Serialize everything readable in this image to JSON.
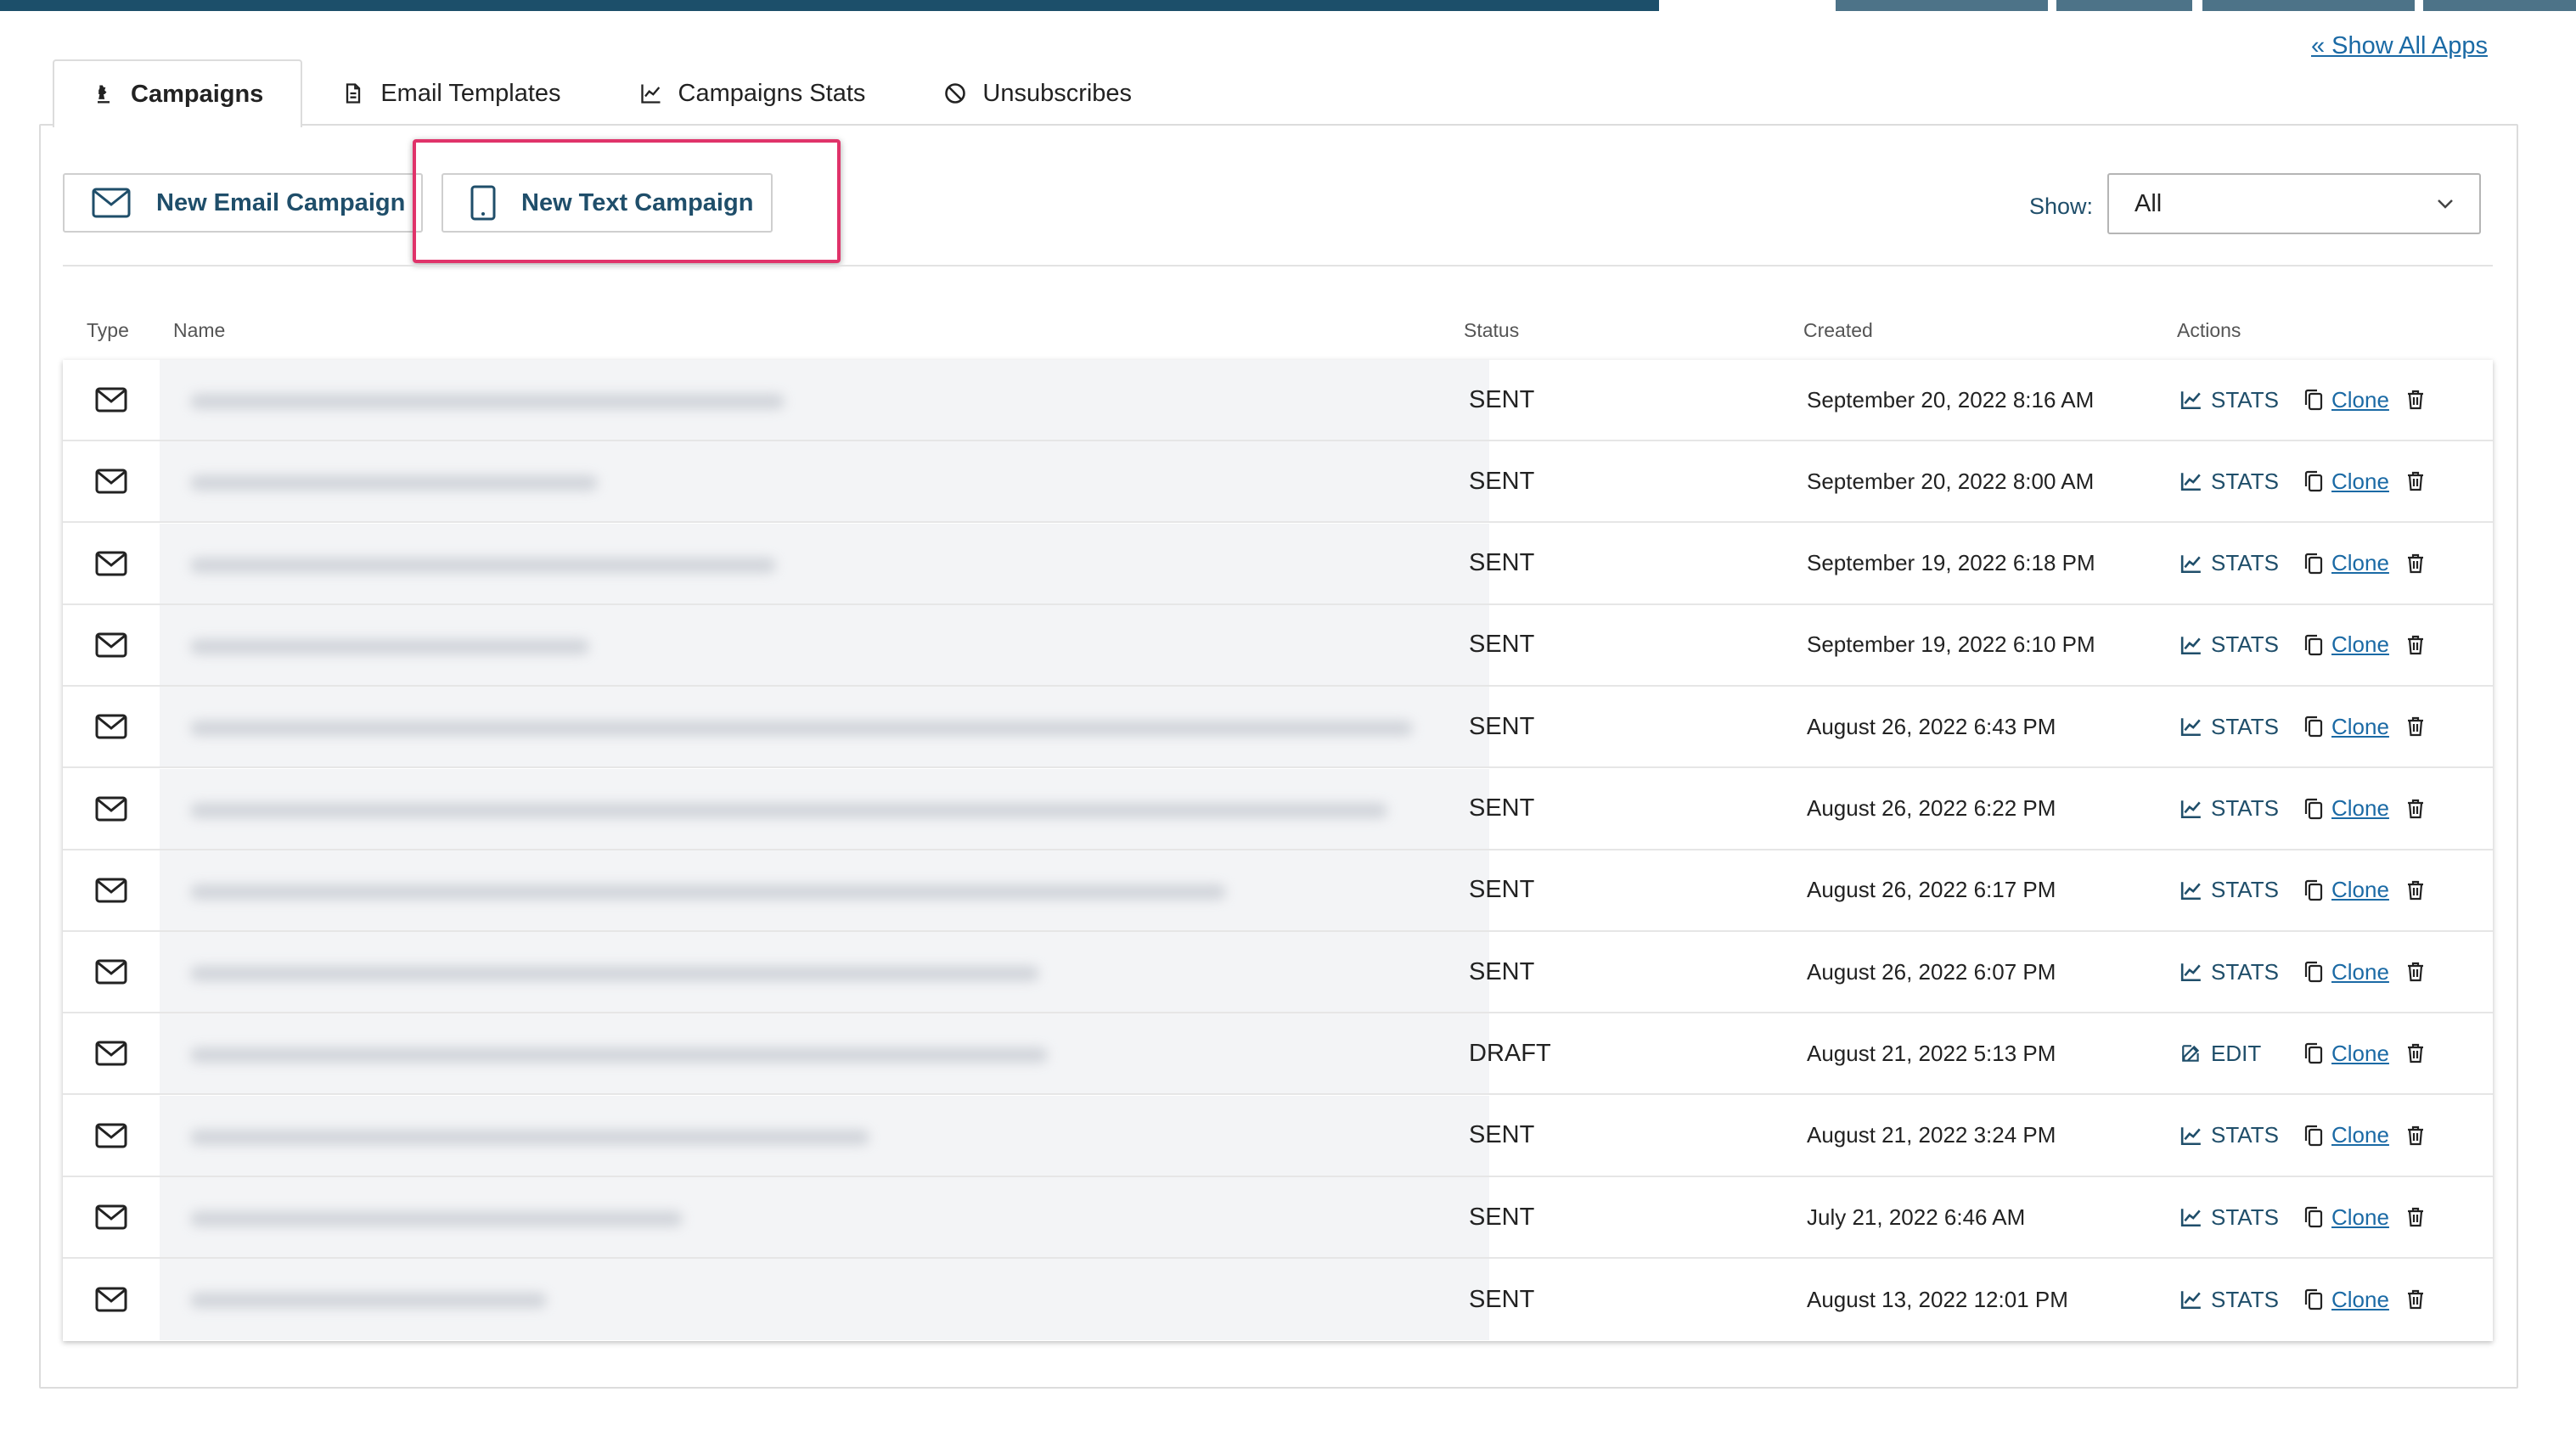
{
  "header": {
    "show_all_apps": "« Show All Apps"
  },
  "tabs": [
    {
      "label": "Campaigns",
      "icon": "chess-knight-icon",
      "active": true
    },
    {
      "label": "Email Templates",
      "icon": "template-icon",
      "active": false
    },
    {
      "label": "Campaigns Stats",
      "icon": "chart-line-icon",
      "active": false
    },
    {
      "label": "Unsubscribes",
      "icon": "ban-icon",
      "active": false
    }
  ],
  "toolbar": {
    "new_email_campaign": "New Email Campaign",
    "new_text_campaign": "New Text Campaign",
    "show_label": "Show:",
    "show_value": "All"
  },
  "table": {
    "headers": {
      "type": "Type",
      "name": "Name",
      "status": "Status",
      "created": "Created",
      "actions": "Actions"
    },
    "rows": [
      {
        "status": "SENT",
        "created": "September 20, 2022 8:16 AM",
        "primary_action": "STATS",
        "clone": "Clone"
      },
      {
        "status": "SENT",
        "created": "September 20, 2022 8:00 AM",
        "primary_action": "STATS",
        "clone": "Clone"
      },
      {
        "status": "SENT",
        "created": "September 19, 2022 6:18 PM",
        "primary_action": "STATS",
        "clone": "Clone"
      },
      {
        "status": "SENT",
        "created": "September 19, 2022 6:10 PM",
        "primary_action": "STATS",
        "clone": "Clone"
      },
      {
        "status": "SENT",
        "created": "August 26, 2022 6:43 PM",
        "primary_action": "STATS",
        "clone": "Clone"
      },
      {
        "status": "SENT",
        "created": "August 26, 2022 6:22 PM",
        "primary_action": "STATS",
        "clone": "Clone"
      },
      {
        "status": "SENT",
        "created": "August 26, 2022 6:17 PM",
        "primary_action": "STATS",
        "clone": "Clone"
      },
      {
        "status": "SENT",
        "created": "August 26, 2022 6:07 PM",
        "primary_action": "STATS",
        "clone": "Clone"
      },
      {
        "status": "DRAFT",
        "created": "August 21, 2022 5:13 PM",
        "primary_action": "EDIT",
        "clone": "Clone"
      },
      {
        "status": "SENT",
        "created": "August 21, 2022 3:24 PM",
        "primary_action": "STATS",
        "clone": "Clone"
      },
      {
        "status": "SENT",
        "created": "July 21, 2022 6:46 AM",
        "primary_action": "STATS",
        "clone": "Clone"
      },
      {
        "status": "SENT",
        "created": "August 13, 2022 12:01 PM",
        "primary_action": "STATS",
        "clone": "Clone"
      }
    ]
  },
  "colors": {
    "brand_dark": "#1c4f6a",
    "link": "#1b6aa5",
    "highlight": "#e0336a"
  }
}
